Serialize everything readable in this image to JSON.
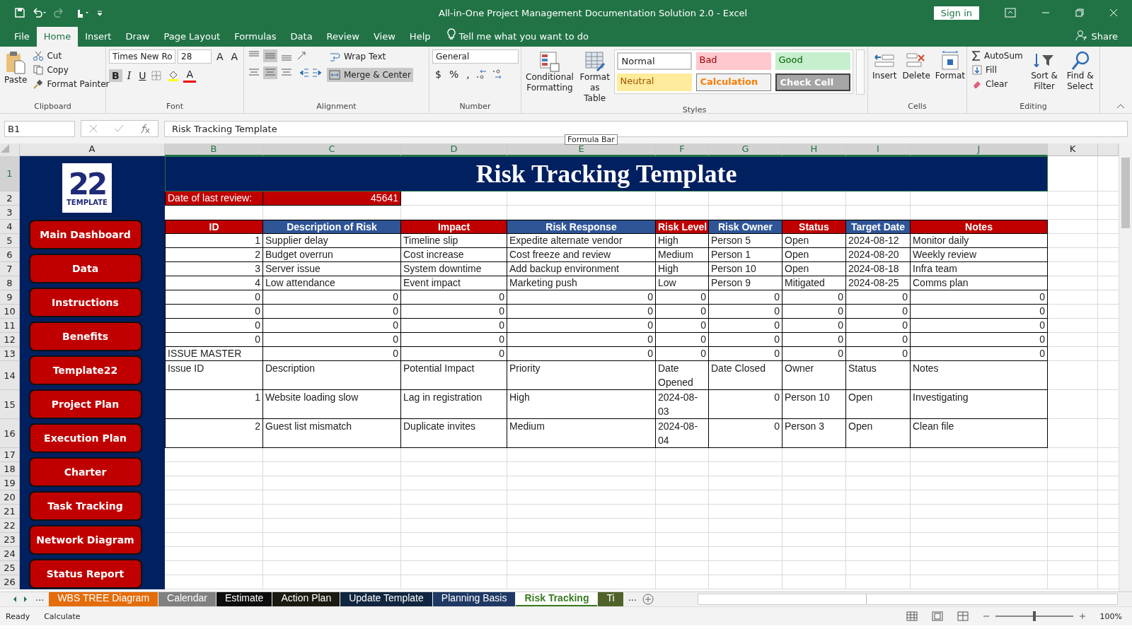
{
  "title_bar": {
    "title": "All-in-One Project Management Documentation Solution 2.0  -  Excel",
    "sign_in": "Sign in"
  },
  "menu_tabs": [
    {
      "label": "File",
      "selected": false
    },
    {
      "label": "Home",
      "selected": true
    },
    {
      "label": "Insert",
      "selected": false
    },
    {
      "label": "Draw",
      "selected": false
    },
    {
      "label": "Page Layout",
      "selected": false
    },
    {
      "label": "Formulas",
      "selected": false
    },
    {
      "label": "Data",
      "selected": false
    },
    {
      "label": "Review",
      "selected": false
    },
    {
      "label": "View",
      "selected": false
    },
    {
      "label": "Help",
      "selected": false
    }
  ],
  "tell_me": "Tell me what you want to do",
  "share": "Share",
  "ribbon": {
    "clipboard": {
      "paste": "Paste",
      "cut": "Cut",
      "copy": "Copy",
      "format_painter": "Format Painter",
      "label": "Clipboard"
    },
    "font": {
      "name": "Times New Ro",
      "size": "28",
      "grow": "A",
      "shrink": "A",
      "bold": "B",
      "italic": "I",
      "underline": "U",
      "font_color": "A",
      "label": "Font"
    },
    "alignment": {
      "wrap_text": "Wrap Text",
      "merge_center": "Merge & Center",
      "label": "Alignment"
    },
    "number": {
      "format": "General",
      "currency": "$",
      "percent": "%",
      "comma": ",",
      "label": "Number"
    },
    "styles": {
      "conditional": "Conditional Formatting",
      "format_table": "Format as Table",
      "label": "Styles",
      "cell_styles": [
        {
          "label": "Normal",
          "kind": "normal"
        },
        {
          "label": "Bad",
          "kind": "bad"
        },
        {
          "label": "Good",
          "kind": "good"
        },
        {
          "label": "Neutral",
          "kind": "neutral"
        },
        {
          "label": "Calculation",
          "kind": "calculation"
        },
        {
          "label": "Check Cell",
          "kind": "check"
        }
      ]
    },
    "cells": {
      "insert": "Insert",
      "delete": "Delete",
      "format": "Format",
      "label": "Cells"
    },
    "editing": {
      "autosum": "AutoSum",
      "fill": "Fill",
      "clear": "Clear",
      "sort_filter": "Sort & Filter",
      "find_select": "Find & Select",
      "label": "Editing"
    }
  },
  "formula_bar": {
    "name_box": "B1",
    "formula": "Risk Tracking Template",
    "tooltip": "Formula Bar"
  },
  "columns": [
    {
      "label": "A",
      "selected": false
    },
    {
      "label": "B",
      "selected": true
    },
    {
      "label": "C",
      "selected": true
    },
    {
      "label": "D",
      "selected": true
    },
    {
      "label": "E",
      "selected": true
    },
    {
      "label": "F",
      "selected": true
    },
    {
      "label": "G",
      "selected": true
    },
    {
      "label": "H",
      "selected": true
    },
    {
      "label": "I",
      "selected": true
    },
    {
      "label": "J",
      "selected": true
    },
    {
      "label": "K",
      "selected": false
    }
  ],
  "row_headers": [
    {
      "label": "1",
      "selected": true
    },
    {
      "label": "2",
      "selected": false
    },
    {
      "label": "3",
      "selected": false
    },
    {
      "label": "4",
      "selected": false
    },
    {
      "label": "5",
      "selected": false
    },
    {
      "label": "6",
      "selected": false
    },
    {
      "label": "7",
      "selected": false
    },
    {
      "label": "8",
      "selected": false
    },
    {
      "label": "9",
      "selected": false
    },
    {
      "label": "10",
      "selected": false
    },
    {
      "label": "11",
      "selected": false
    },
    {
      "label": "12",
      "selected": false
    },
    {
      "label": "13",
      "selected": false
    },
    {
      "label": "14",
      "selected": false
    },
    {
      "label": "15",
      "selected": false
    },
    {
      "label": "16",
      "selected": false
    },
    {
      "label": "17",
      "selected": false
    },
    {
      "label": "18",
      "selected": false
    },
    {
      "label": "19",
      "selected": false
    },
    {
      "label": "20",
      "selected": false
    },
    {
      "label": "21",
      "selected": false
    },
    {
      "label": "22",
      "selected": false
    },
    {
      "label": "23",
      "selected": false
    },
    {
      "label": "24",
      "selected": false
    },
    {
      "label": "25",
      "selected": false
    },
    {
      "label": "26",
      "selected": false
    }
  ],
  "sidebar": {
    "logo_number": "22",
    "logo_word": "TEMPLATE",
    "nav": [
      "Main Dashboard",
      "Data",
      "Instructions",
      "Benefits",
      "Template22",
      "Project Plan",
      "Execution Plan",
      "Charter",
      "Task Tracking",
      "Network Diagram",
      "Status Report"
    ]
  },
  "sheet": {
    "title": "Risk Tracking Template",
    "review_label": "Date of last review:",
    "review_value": "45641",
    "header": [
      {
        "label": "ID",
        "color": "#c00000"
      },
      {
        "label": "Description of Risk",
        "color": "#2f5597"
      },
      {
        "label": "Impact",
        "color": "#c00000"
      },
      {
        "label": "Risk Response",
        "color": "#2f5597"
      },
      {
        "label": "Risk Level",
        "color": "#c00000"
      },
      {
        "label": "Risk Owner",
        "color": "#2f5597"
      },
      {
        "label": "Status",
        "color": "#c00000"
      },
      {
        "label": "Target Date",
        "color": "#2f5597"
      },
      {
        "label": "Notes",
        "color": "#c00000"
      }
    ],
    "rows": [
      {
        "tall": false,
        "cells": [
          {
            "text": "1",
            "kind": "number"
          },
          {
            "text": "Supplier delay",
            "kind": "text"
          },
          {
            "text": "Timeline slip",
            "kind": "text"
          },
          {
            "text": "Expedite alternate vendor",
            "kind": "text"
          },
          {
            "text": "High",
            "kind": "text"
          },
          {
            "text": "Person 5",
            "kind": "text"
          },
          {
            "text": "Open",
            "kind": "text"
          },
          {
            "text": "2024-08-12",
            "kind": "text"
          },
          {
            "text": "Monitor daily",
            "kind": "text"
          }
        ]
      },
      {
        "tall": false,
        "cells": [
          {
            "text": "2",
            "kind": "number"
          },
          {
            "text": "Budget overrun",
            "kind": "text"
          },
          {
            "text": "Cost increase",
            "kind": "text"
          },
          {
            "text": "Cost freeze and review",
            "kind": "text"
          },
          {
            "text": "Medium",
            "kind": "text"
          },
          {
            "text": "Person 1",
            "kind": "text"
          },
          {
            "text": "Open",
            "kind": "text"
          },
          {
            "text": "2024-08-20",
            "kind": "text"
          },
          {
            "text": "Weekly review",
            "kind": "text"
          }
        ]
      },
      {
        "tall": false,
        "cells": [
          {
            "text": "3",
            "kind": "number"
          },
          {
            "text": "Server issue",
            "kind": "text"
          },
          {
            "text": "System downtime",
            "kind": "text"
          },
          {
            "text": "Add backup environment",
            "kind": "text"
          },
          {
            "text": "High",
            "kind": "text"
          },
          {
            "text": "Person 10",
            "kind": "text"
          },
          {
            "text": "Open",
            "kind": "text"
          },
          {
            "text": "2024-08-18",
            "kind": "text"
          },
          {
            "text": "Infra team",
            "kind": "text"
          }
        ]
      },
      {
        "tall": false,
        "cells": [
          {
            "text": "4",
            "kind": "number"
          },
          {
            "text": "Low attendance",
            "kind": "text"
          },
          {
            "text": "Event impact",
            "kind": "text"
          },
          {
            "text": "Marketing push",
            "kind": "text"
          },
          {
            "text": "Low",
            "kind": "text"
          },
          {
            "text": "Person 9",
            "kind": "text"
          },
          {
            "text": "Mitigated",
            "kind": "text"
          },
          {
            "text": "2024-08-25",
            "kind": "text"
          },
          {
            "text": "Comms plan",
            "kind": "text"
          }
        ]
      },
      {
        "tall": false,
        "cells": [
          {
            "text": "0",
            "kind": "number"
          },
          {
            "text": "0",
            "kind": "number"
          },
          {
            "text": "0",
            "kind": "number"
          },
          {
            "text": "0",
            "kind": "number"
          },
          {
            "text": "0",
            "kind": "number"
          },
          {
            "text": "0",
            "kind": "number"
          },
          {
            "text": "0",
            "kind": "number"
          },
          {
            "text": "0",
            "kind": "number"
          },
          {
            "text": "0",
            "kind": "number"
          }
        ]
      },
      {
        "tall": false,
        "cells": [
          {
            "text": "0",
            "kind": "number"
          },
          {
            "text": "0",
            "kind": "number"
          },
          {
            "text": "0",
            "kind": "number"
          },
          {
            "text": "0",
            "kind": "number"
          },
          {
            "text": "0",
            "kind": "number"
          },
          {
            "text": "0",
            "kind": "number"
          },
          {
            "text": "0",
            "kind": "number"
          },
          {
            "text": "0",
            "kind": "number"
          },
          {
            "text": "0",
            "kind": "number"
          }
        ]
      },
      {
        "tall": false,
        "cells": [
          {
            "text": "0",
            "kind": "number"
          },
          {
            "text": "0",
            "kind": "number"
          },
          {
            "text": "0",
            "kind": "number"
          },
          {
            "text": "0",
            "kind": "number"
          },
          {
            "text": "0",
            "kind": "number"
          },
          {
            "text": "0",
            "kind": "number"
          },
          {
            "text": "0",
            "kind": "number"
          },
          {
            "text": "0",
            "kind": "number"
          },
          {
            "text": "0",
            "kind": "number"
          }
        ]
      },
      {
        "tall": false,
        "cells": [
          {
            "text": "0",
            "kind": "number"
          },
          {
            "text": "0",
            "kind": "number"
          },
          {
            "text": "0",
            "kind": "number"
          },
          {
            "text": "0",
            "kind": "number"
          },
          {
            "text": "0",
            "kind": "number"
          },
          {
            "text": "0",
            "kind": "number"
          },
          {
            "text": "0",
            "kind": "number"
          },
          {
            "text": "0",
            "kind": "number"
          },
          {
            "text": "0",
            "kind": "number"
          }
        ]
      },
      {
        "tall": false,
        "cells": [
          {
            "text": "ISSUE MASTER",
            "kind": "text"
          },
          {
            "text": "0",
            "kind": "number"
          },
          {
            "text": "0",
            "kind": "number"
          },
          {
            "text": "0",
            "kind": "number"
          },
          {
            "text": "0",
            "kind": "number"
          },
          {
            "text": "0",
            "kind": "number"
          },
          {
            "text": "0",
            "kind": "number"
          },
          {
            "text": "0",
            "kind": "number"
          },
          {
            "text": "0",
            "kind": "number"
          }
        ]
      },
      {
        "tall": true,
        "cells": [
          {
            "text": "Issue ID",
            "kind": "text"
          },
          {
            "text": "Description",
            "kind": "text"
          },
          {
            "text": "Potential Impact",
            "kind": "text"
          },
          {
            "text": "Priority",
            "kind": "text"
          },
          {
            "text": "Date Opened",
            "kind": "text"
          },
          {
            "text": "Date Closed",
            "kind": "text"
          },
          {
            "text": "Owner",
            "kind": "text"
          },
          {
            "text": "Status",
            "kind": "text"
          },
          {
            "text": "Notes",
            "kind": "text"
          }
        ]
      },
      {
        "tall": true,
        "cells": [
          {
            "text": "1",
            "kind": "number"
          },
          {
            "text": "Website loading slow",
            "kind": "text"
          },
          {
            "text": "Lag in registration",
            "kind": "text"
          },
          {
            "text": "High",
            "kind": "text"
          },
          {
            "text": "2024-08-03",
            "kind": "text"
          },
          {
            "text": "0",
            "kind": "number"
          },
          {
            "text": "Person 10",
            "kind": "text"
          },
          {
            "text": "Open",
            "kind": "text"
          },
          {
            "text": "Investigating",
            "kind": "text"
          }
        ]
      },
      {
        "tall": true,
        "cells": [
          {
            "text": "2",
            "kind": "number"
          },
          {
            "text": "Guest list mismatch",
            "kind": "text"
          },
          {
            "text": "Duplicate invites",
            "kind": "text"
          },
          {
            "text": "Medium",
            "kind": "text"
          },
          {
            "text": "2024-08-04",
            "kind": "text"
          },
          {
            "text": "0",
            "kind": "number"
          },
          {
            "text": "Person 3",
            "kind": "text"
          },
          {
            "text": "Open",
            "kind": "text"
          },
          {
            "text": "Clean file",
            "kind": "text"
          }
        ]
      }
    ]
  },
  "sheet_tabs": {
    "nav_more": "...",
    "more": "...",
    "tabs": [
      {
        "label": "WBS TREE Diagram",
        "color": "#e46c0a",
        "selected": false
      },
      {
        "label": "Calendar",
        "color": "#808080",
        "selected": false
      },
      {
        "label": "Estimate",
        "color": "#0d0d0d",
        "selected": false
      },
      {
        "label": "Action Plan",
        "color": "#1a1a10",
        "selected": false
      },
      {
        "label": "Update Template",
        "color": "#10253f",
        "selected": false
      },
      {
        "label": "Planning Basis",
        "color": "#1f3864",
        "selected": false
      },
      {
        "label": "Risk Tracking",
        "color": "#3a7d22",
        "selected": true
      },
      {
        "label": "Ti",
        "color": "#4f6228",
        "selected": false
      }
    ]
  },
  "status_bar": {
    "ready": "Ready",
    "calculate": "Calculate",
    "zoom": "100%",
    "zoom_slider": {
      "level": 0.5
    }
  }
}
